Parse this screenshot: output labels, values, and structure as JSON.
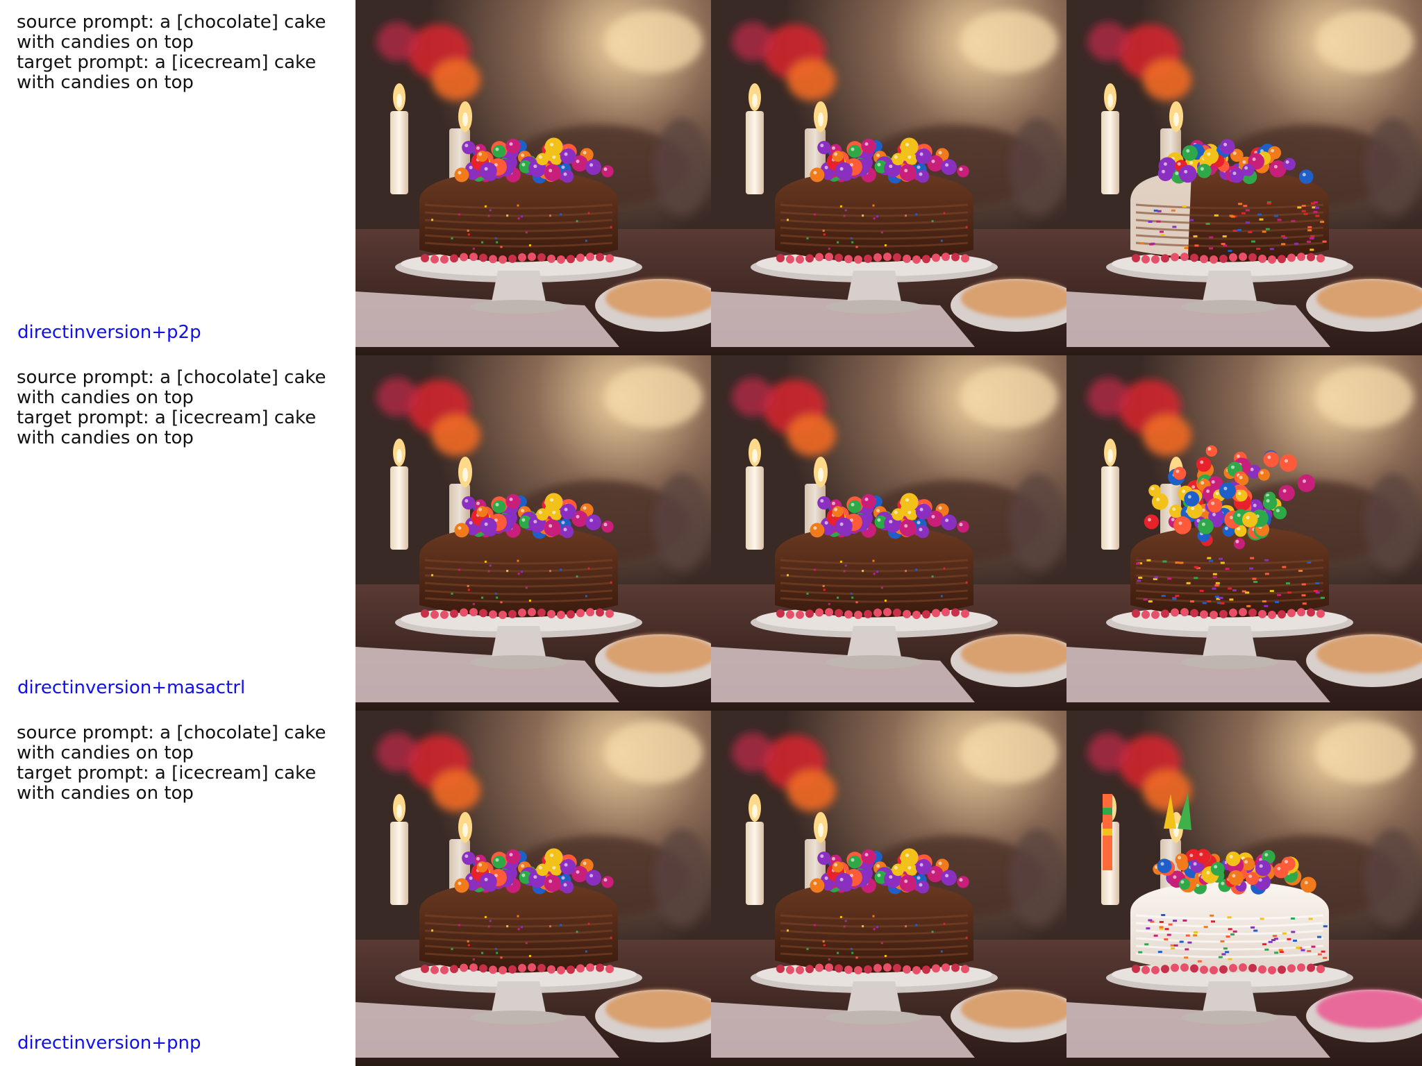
{
  "rows": [
    {
      "source_prompt": "source prompt: a [chocolate] cake with candies on top",
      "target_prompt": "target prompt: a [icecream] cake with candies on top",
      "method": "directinversion+p2p",
      "images": [
        {
          "variant": "source-chocolate-cake"
        },
        {
          "variant": "reconstruction-chocolate-cake"
        },
        {
          "variant": "edited-partial-icecream-cake"
        }
      ]
    },
    {
      "source_prompt": "source prompt: a [chocolate] cake with candies on top",
      "target_prompt": "target prompt: a [icecream] cake with candies on top",
      "method": "directinversion+masactrl",
      "images": [
        {
          "variant": "source-chocolate-cake"
        },
        {
          "variant": "reconstruction-chocolate-cake"
        },
        {
          "variant": "edited-tall-candy-pile"
        }
      ]
    },
    {
      "source_prompt": "source prompt: a [chocolate] cake with candies on top",
      "target_prompt": "target prompt: a [icecream] cake with candies on top",
      "method": "directinversion+pnp",
      "images": [
        {
          "variant": "source-chocolate-cake"
        },
        {
          "variant": "reconstruction-chocolate-cake"
        },
        {
          "variant": "edited-white-icecream-cake"
        }
      ]
    }
  ],
  "colors": {
    "method_label": "#1010ee",
    "chocolate": "#4a2414",
    "icecream": "#f3ece6"
  }
}
